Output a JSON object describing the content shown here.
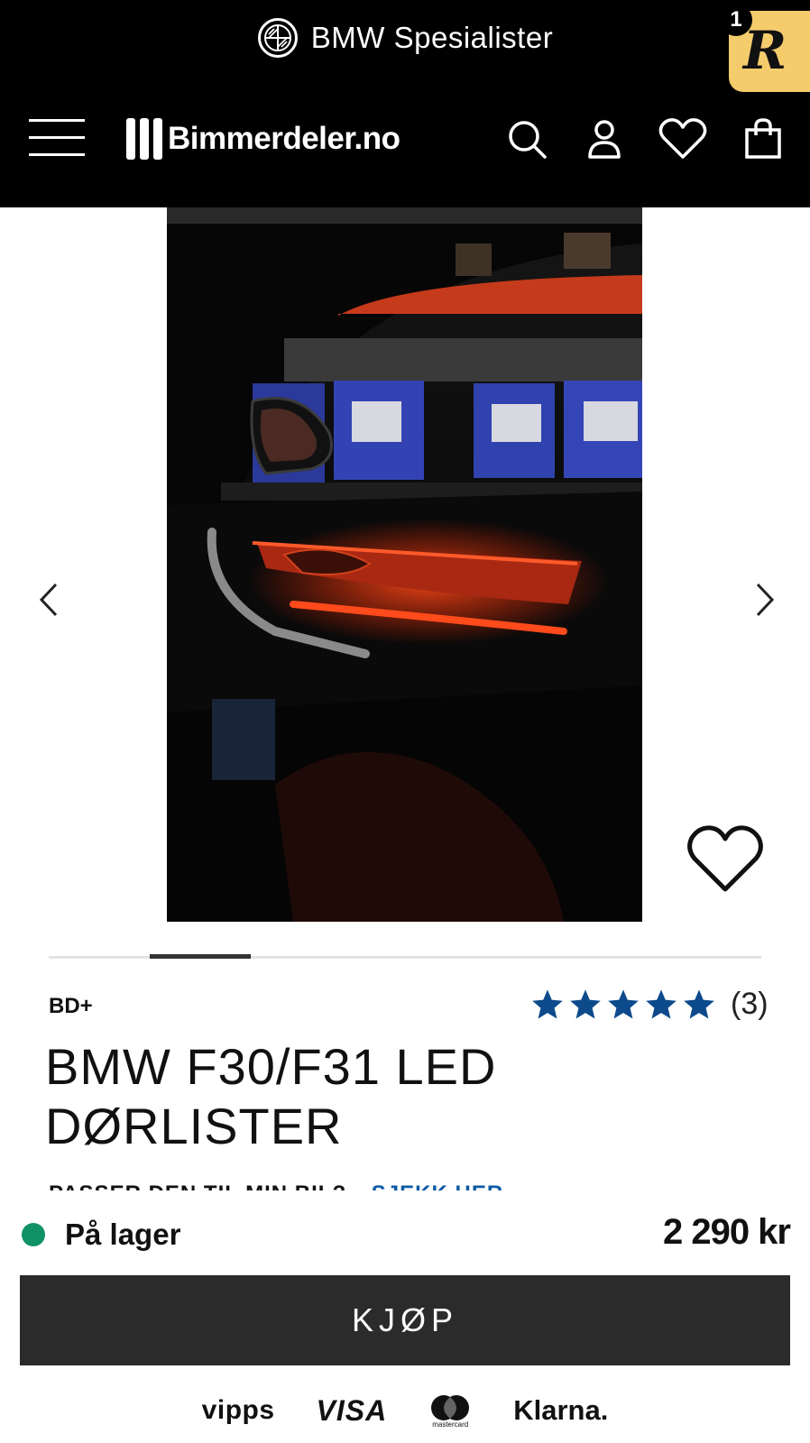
{
  "header": {
    "banner_title": "BMW Spesialister",
    "badge_count": "1",
    "badge_letter": "R",
    "brand_name": "Bimmerdeler.no"
  },
  "icons": {
    "menu": "hamburger-icon",
    "search": "search-icon",
    "account": "user-icon",
    "wishlist": "heart-icon",
    "cart": "shopping-bag-icon",
    "prev": "chevron-left-icon",
    "next": "chevron-right-icon",
    "star": "star-icon"
  },
  "gallery": {
    "current_slide_fraction": 0.14
  },
  "product": {
    "brand": "BD+",
    "rating": 5,
    "review_count": "(3)",
    "title": "BMW F30/F31 LED DØRLISTER",
    "compat_question": "PASSER DEN TIL MIN BIL?",
    "compat_link": "SJEKK HER"
  },
  "purchase": {
    "stock_status": "På lager",
    "price": "2 290 kr",
    "buy_label": "KJØP"
  },
  "payments": {
    "vipps": "vipps",
    "visa": "VISA",
    "mastercard": "mastercard",
    "klarna": "Klarna."
  },
  "colors": {
    "header_bg": "#000000",
    "badge_bg": "#f5cc6c",
    "star": "#0c4a8c",
    "stock_dot": "#119266",
    "buy_button": "#2b2b2b",
    "link": "#0c5aa6"
  }
}
